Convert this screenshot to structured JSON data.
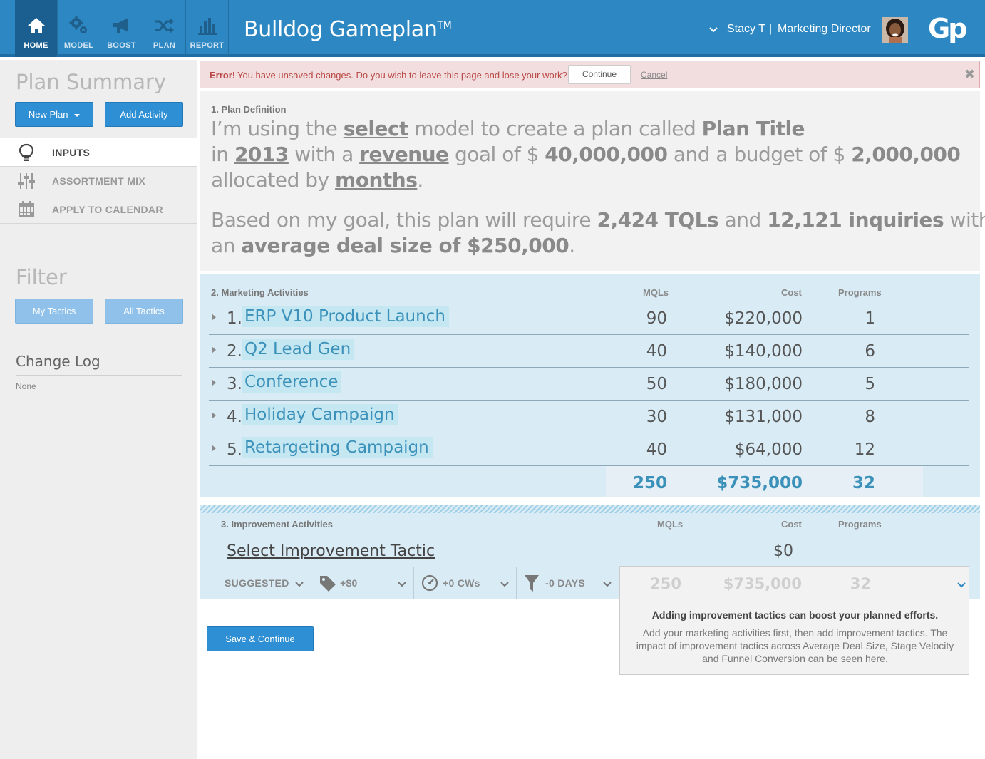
{
  "header": {
    "nav": [
      {
        "label": "HOME",
        "icon": "home-icon",
        "active": true
      },
      {
        "label": "MODEL",
        "icon": "gears-icon",
        "active": false
      },
      {
        "label": "BOOST",
        "icon": "megaphone-icon",
        "active": false
      },
      {
        "label": "PLAN",
        "icon": "shuffle-icon",
        "active": false
      },
      {
        "label": "REPORT",
        "icon": "bar-chart-icon",
        "active": false
      }
    ],
    "app_title": "Bulldog Gameplan",
    "app_title_tm": "TM",
    "user_name": "Stacy T",
    "user_separator": "|",
    "user_role": "Marketing Director",
    "logo_text": "Gp"
  },
  "sidebar": {
    "plan_summary_title": "Plan Summary",
    "new_plan_label": "New Plan",
    "add_activity_label": "Add Activity",
    "items": [
      {
        "label": "INPUTS",
        "icon": "lightbulb-icon",
        "active": true
      },
      {
        "label": "ASSORTMENT MIX",
        "icon": "sliders-icon",
        "active": false
      },
      {
        "label": "APPLY TO CALENDAR",
        "icon": "calendar-icon",
        "active": false
      }
    ],
    "filter_title": "Filter",
    "my_tactics_label": "My Tactics",
    "all_tactics_label": "All Tactics",
    "change_log_title": "Change Log",
    "change_log_empty": "None"
  },
  "error": {
    "strong": "Error!",
    "message": "You have unsaved changes. Do you wish to leave this page and lose your work?",
    "continue_label": "Continue",
    "cancel_label": "Cancel",
    "close_glyph": "✖"
  },
  "definition": {
    "section_label": "1. Plan Definition",
    "l1_a": "I’m using the ",
    "model": "select",
    "l1_b": " model to create a plan called ",
    "plan_title": "Plan Title",
    "l2_a": "in ",
    "year": "2013",
    "l2_b": " with a ",
    "goal_type": "revenue",
    "l2_c": " goal of $ ",
    "goal_amount": "40,000,000",
    "l2_d": " and a budget of $ ",
    "budget": "2,000,000",
    "l3_a": "allocated by ",
    "allocation": "months",
    "l3_b": ".",
    "l4_a": "Based on my goal, this plan will require ",
    "tqls": "2,424 TQLs",
    "l4_b": " and ",
    "inquiries": "12,121 inquiries",
    "l4_c": " with",
    "l5_a": "an ",
    "avg_deal": "average deal size of $250,000",
    "l5_b": "."
  },
  "activities": {
    "section_label": "2. Marketing Activities",
    "col_mqls": "MQLs",
    "col_cost": "Cost",
    "col_programs": "Programs",
    "rows": [
      {
        "num": "1.",
        "name": "ERP V10 Product Launch",
        "mqls": "90",
        "cost": "$220,000",
        "programs": "1"
      },
      {
        "num": "2.",
        "name": "Q2 Lead Gen",
        "mqls": "40",
        "cost": "$140,000",
        "programs": "6"
      },
      {
        "num": "3.",
        "name": "Conference",
        "mqls": "50",
        "cost": "$180,000",
        "programs": "5"
      },
      {
        "num": "4.",
        "name": "Holiday Campaign",
        "mqls": "30",
        "cost": "$131,000",
        "programs": "8"
      },
      {
        "num": "5.",
        "name": "Retargeting Campaign",
        "mqls": "40",
        "cost": "$64,000",
        "programs": "12"
      }
    ],
    "totals": {
      "mqls": "250",
      "cost": "$735,000",
      "programs": "32"
    }
  },
  "improvement": {
    "section_label": "3. Improvement Activities",
    "col_mqls": "MQLs",
    "col_cost": "Cost",
    "col_programs": "Programs",
    "select_label": "Select Improvement Tactic",
    "cost": "$0",
    "dropdowns": [
      {
        "label": "SUGGESTED",
        "icon": ""
      },
      {
        "label": "+$0",
        "icon": "tag-icon"
      },
      {
        "label": "+0 CWs",
        "icon": "speedometer-icon"
      },
      {
        "label": "-0 DAYS",
        "icon": "funnel-icon"
      }
    ],
    "impact": {
      "mqls": "250",
      "cost": "$735,000",
      "programs": "32",
      "heading": "Adding improvement tactics can boost your planned efforts.",
      "body": "Add your marketing activities first, then add improvement tactics. The impact of improvement tactics across Average Deal Size, Stage Velocity and Funnel Conversion can be seen here."
    }
  },
  "save_label": "Save & Continue",
  "colors": {
    "brand": "#2c87c2",
    "accent_text": "#3b91b9",
    "error_bg": "#f2dede",
    "error_text": "#b94a48"
  }
}
